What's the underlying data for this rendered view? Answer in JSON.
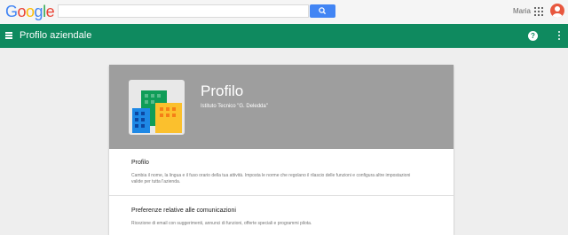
{
  "topbar": {
    "logo_letters": [
      {
        "ch": "G",
        "color": "#4285f4"
      },
      {
        "ch": "o",
        "color": "#ea4335"
      },
      {
        "ch": "o",
        "color": "#fbbc05"
      },
      {
        "ch": "g",
        "color": "#4285f4"
      },
      {
        "ch": "l",
        "color": "#34a853"
      },
      {
        "ch": "e",
        "color": "#ea4335"
      }
    ],
    "search": {
      "value": "",
      "placeholder": ""
    },
    "user_name": "Maria"
  },
  "appbar": {
    "title": "Profilo aziendale",
    "color": "#0f8a5f"
  },
  "banner": {
    "title": "Profilo",
    "subtitle": "Istituto Tecnico \"G. Deledda\""
  },
  "sections": [
    {
      "title": "Profilo",
      "description": "Cambia il nome, la lingua e il fuso orario della tua attività. Imposta le norme che regolano il rilascio delle funzioni e configura altre impostazioni valide per tutta l'azienda."
    },
    {
      "title": "Preferenze relative alle comunicazioni",
      "description": "Ricezione di email con suggerimenti, annunci di funzioni, offerte speciali e programmi pilota."
    }
  ]
}
